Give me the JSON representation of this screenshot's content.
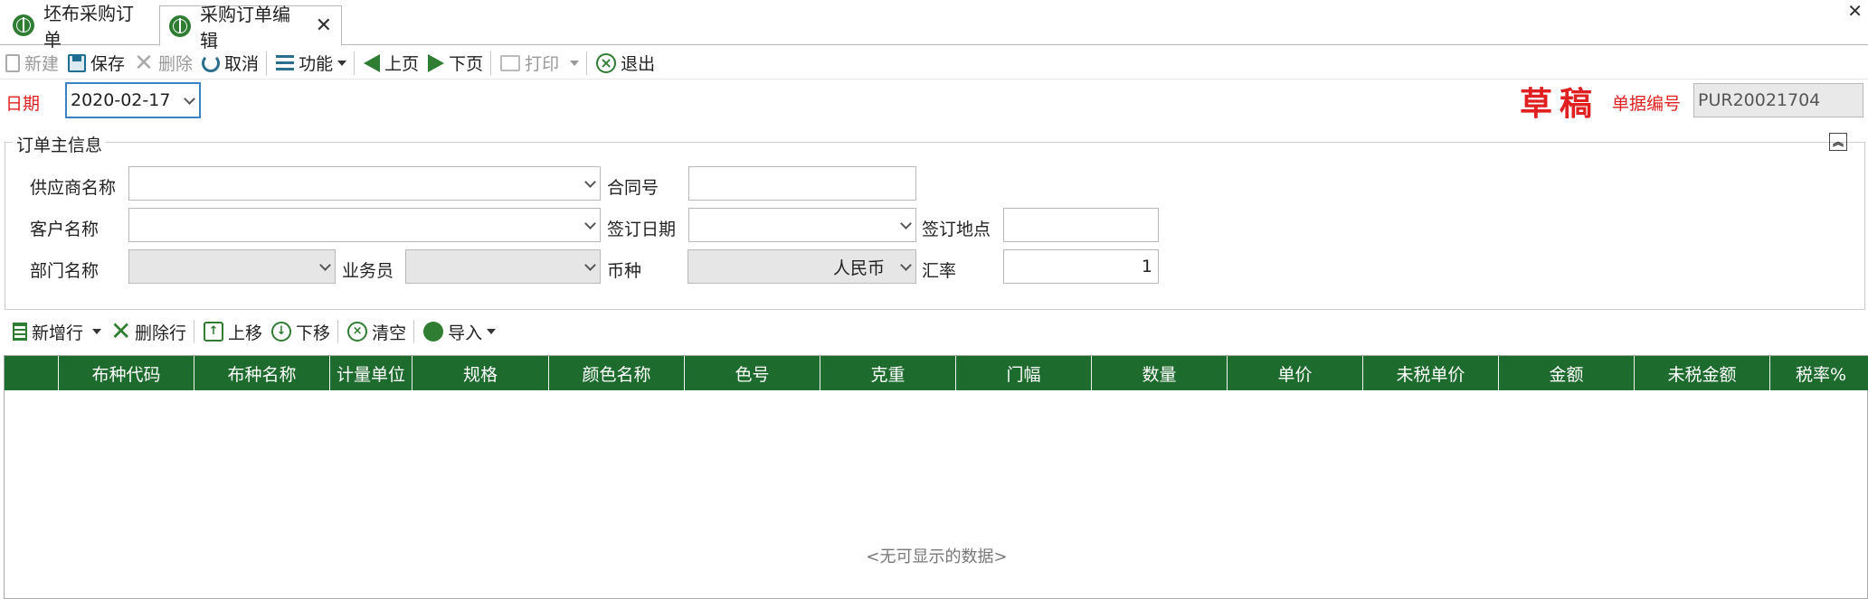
{
  "tabs": [
    {
      "label": "坯布采购订单",
      "icon": "globe-icon"
    },
    {
      "label": "采购订单编辑",
      "icon": "globe-icon",
      "active": true
    }
  ],
  "toolbar": {
    "new": "新建",
    "save": "保存",
    "delete": "删除",
    "cancel": "取消",
    "function": "功能",
    "prev": "上页",
    "next": "下页",
    "print": "打印",
    "exit": "退出"
  },
  "header": {
    "date_label": "日期",
    "date_value": "2020-02-17",
    "status": "草稿",
    "doc_no_label": "单据编号",
    "doc_no_value": "PUR20021704"
  },
  "group": {
    "title": "订单主信息",
    "supplier_label": "供应商名称",
    "contract_label": "合同号",
    "customer_label": "客户名称",
    "sign_date_label": "签订日期",
    "sign_place_label": "签订地点",
    "dept_label": "部门名称",
    "salesman_label": "业务员",
    "currency_label": "币种",
    "currency_value": "人民币",
    "rate_label": "汇率",
    "rate_value": "1"
  },
  "gridbar": {
    "add_row": "新增行",
    "del_row": "删除行",
    "move_up": "上移",
    "move_down": "下移",
    "clear": "清空",
    "import": "导入"
  },
  "grid": {
    "columns": [
      "",
      "布种代码",
      "布种名称",
      "计量单位",
      "规格",
      "颜色名称",
      "色号",
      "克重",
      "门幅",
      "数量",
      "单价",
      "未税单价",
      "金额",
      "未税金额",
      "税率%"
    ],
    "empty_text": "<无可显示的数据>"
  },
  "colors": {
    "accent_green": "#1e6b2e",
    "alert_red": "#e02020",
    "focus_blue": "#3b82c4"
  }
}
